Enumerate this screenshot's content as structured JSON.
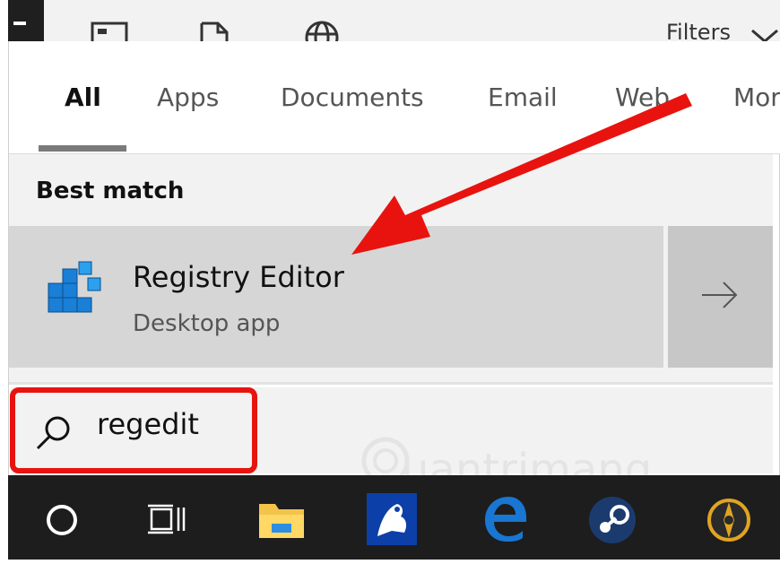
{
  "toolbar": {
    "filters_label": "Filters"
  },
  "tabs": [
    {
      "label": "All",
      "active": true
    },
    {
      "label": "Apps",
      "active": false
    },
    {
      "label": "Documents",
      "active": false
    },
    {
      "label": "Email",
      "active": false
    },
    {
      "label": "Web",
      "active": false
    },
    {
      "label": "Mor",
      "active": false
    }
  ],
  "best_match": {
    "heading": "Best match",
    "result": {
      "title": "Registry Editor",
      "subtitle": "Desktop app",
      "icon": "registry-editor-icon"
    },
    "open_arrow_icon": "arrow-right-icon"
  },
  "search": {
    "query": "regedit",
    "icon": "search-icon"
  },
  "taskbar": {
    "icons": [
      "cortana-circle-icon",
      "task-view-icon",
      "file-explorer-icon",
      "app-frog-icon",
      "edge-icon",
      "steam-icon",
      "app-round-icon"
    ]
  },
  "watermark": {
    "text": "uantrimang"
  },
  "colors": {
    "highlight_red": "#e8130f",
    "taskbar_bg": "#1d1d1d",
    "result_bg": "#d6d6d6"
  }
}
